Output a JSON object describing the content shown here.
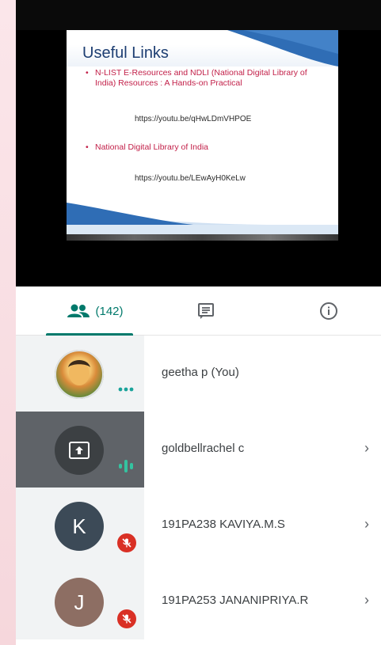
{
  "slide": {
    "title": "Useful Links",
    "bullet1": "N-LIST E-Resources and NDLI (National Digital Library of India) Resources : A Hands-on Practical",
    "link1": "https://youtu.be/qHwLDmVHPOE",
    "bullet2": "National Digital Library of India",
    "link2": "https://youtu.be/LEwAyH0KeLw"
  },
  "tabs": {
    "people_count": "(142)",
    "active": "people"
  },
  "participants": [
    {
      "name": "geetha p (You)",
      "avatar": "photo",
      "status": "more-options",
      "chevron": false
    },
    {
      "name": "goldbellrachel c",
      "avatar": "present-screen-icon",
      "status": "speaking",
      "chevron": true,
      "chevron_glyph": "›"
    },
    {
      "name": "191PA238 KAVIYA.M.S",
      "avatar_letter": "K",
      "avatar_color": "#3c4a57",
      "status": "muted",
      "chevron": true,
      "chevron_glyph": "›"
    },
    {
      "name": "191PA253 JANANIPRIYA.R",
      "avatar_letter": "J",
      "avatar_color": "#8d6e63",
      "status": "muted",
      "chevron": true,
      "chevron_glyph": "›"
    }
  ],
  "colors": {
    "accent": "#00796b",
    "muted_badge": "#d93025",
    "slide_title": "#1d3e72",
    "slide_bullet": "#c21f48"
  }
}
